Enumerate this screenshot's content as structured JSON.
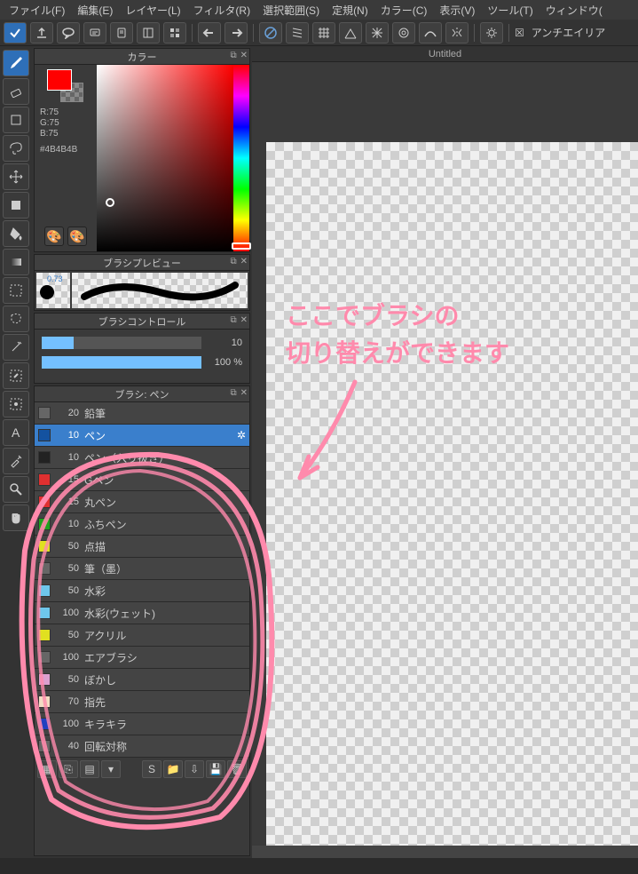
{
  "menu": {
    "file": "ファイル(F)",
    "edit": "編集(E)",
    "layer": "レイヤー(L)",
    "filter": "フィルタ(R)",
    "select": "選択範囲(S)",
    "norm": "定規(N)",
    "color": "カラー(C)",
    "view": "表示(V)",
    "tool": "ツール(T)",
    "window": "ウィンドウ("
  },
  "antialiasing_label": "アンチエイリア",
  "canvas_tab": "Untitled",
  "panels": {
    "color_title": "カラー",
    "brush_preview_title": "ブラシプレビュー",
    "brush_control_title": "ブラシコントロール",
    "brush_list_title": "ブラシ: ペン"
  },
  "color_readout": {
    "r": "R:75",
    "g": "G:75",
    "b": "B:75",
    "hex": "#4B4B4B"
  },
  "brush_preview_size": "0.73",
  "brush_control": {
    "size_val": "10",
    "opacity_val": "100 %"
  },
  "brushes": [
    {
      "color": "#666666",
      "size": "20",
      "name": "鉛筆"
    },
    {
      "color": "#1452a0",
      "size": "10",
      "name": "ペン",
      "selected": true
    },
    {
      "color": "#222222",
      "size": "10",
      "name": "ペン（入り抜き）"
    },
    {
      "color": "#e03030",
      "size": "15",
      "name": "Gペン"
    },
    {
      "color": "#e03030",
      "size": "15",
      "name": "丸ペン"
    },
    {
      "color": "#1ea31e",
      "size": "10",
      "name": "ふちペン"
    },
    {
      "color": "#e0e020",
      "size": "50",
      "name": "点描"
    },
    {
      "color": "#666666",
      "size": "50",
      "name": "筆（墨）"
    },
    {
      "color": "#6ec6eb",
      "size": "50",
      "name": "水彩"
    },
    {
      "color": "#6ec6eb",
      "size": "100",
      "name": "水彩(ウェット)"
    },
    {
      "color": "#e0e020",
      "size": "50",
      "name": "アクリル"
    },
    {
      "color": "#666666",
      "size": "100",
      "name": "エアブラシ"
    },
    {
      "color": "#dca0d0",
      "size": "50",
      "name": "ぼかし"
    },
    {
      "color": "#f3dcc4",
      "size": "70",
      "name": "指先"
    },
    {
      "color": "#2040c0",
      "size": "100",
      "name": "キラキラ"
    },
    {
      "color": "#666666",
      "size": "40",
      "name": "回転対称"
    }
  ],
  "annotation": {
    "line1": "ここでブラシの",
    "line2": "切り替えができます"
  }
}
